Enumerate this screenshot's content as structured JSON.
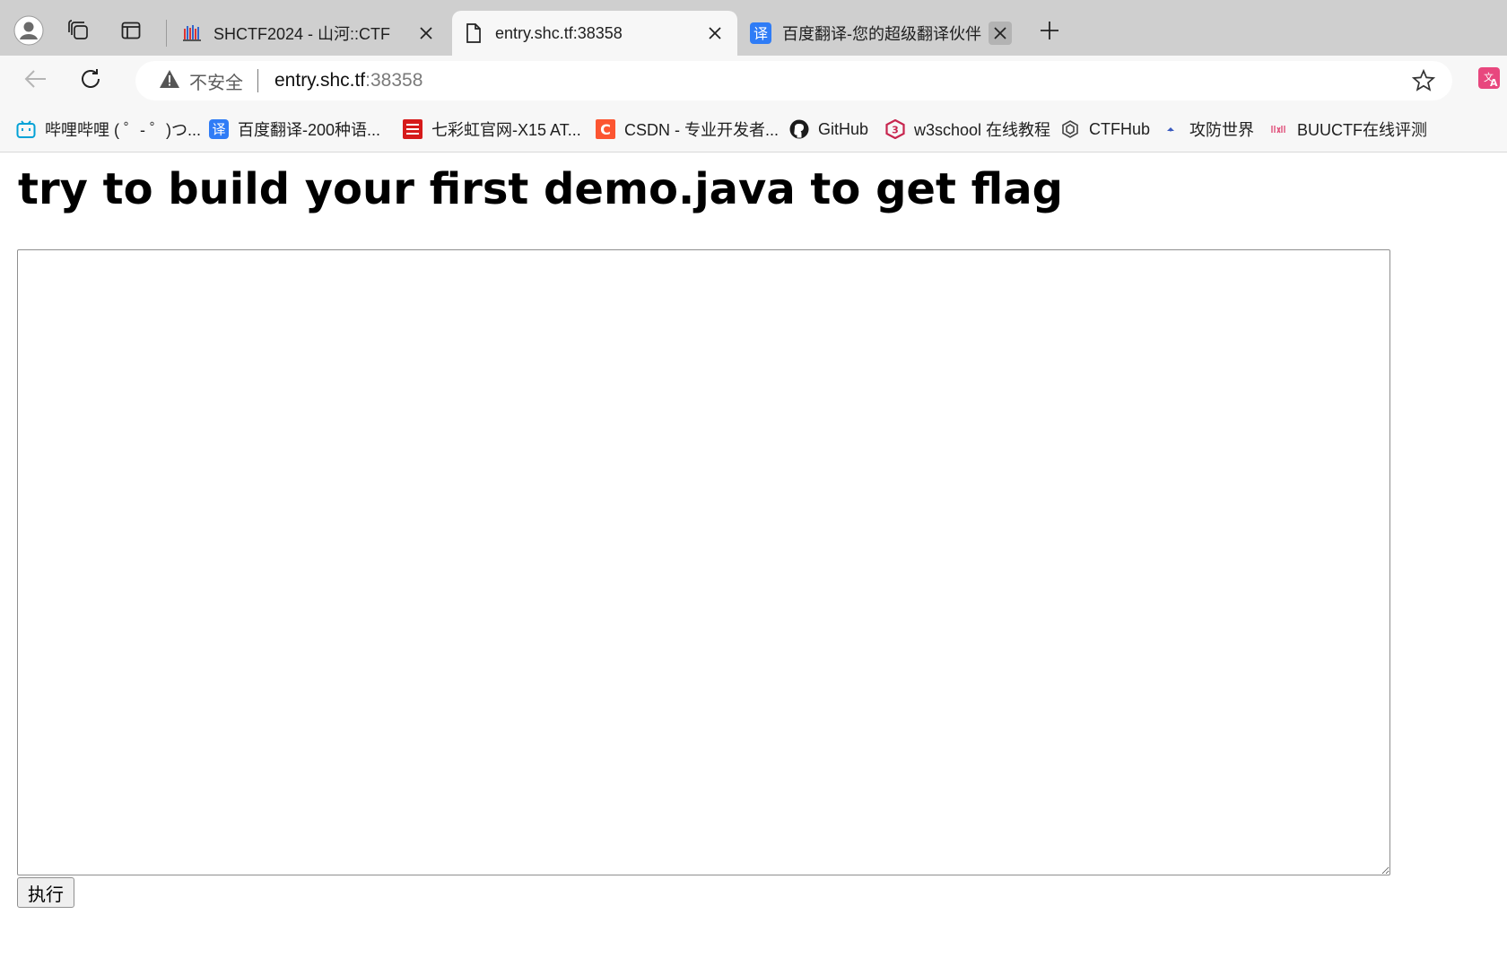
{
  "tabs": [
    {
      "title": "SHCTF2024 - 山河::CTF",
      "active": false
    },
    {
      "title": "entry.shc.tf:38358",
      "active": true
    },
    {
      "title": "百度翻译-您的超级翻译伙伴（文",
      "active": false
    }
  ],
  "address_bar": {
    "security_label": "不安全",
    "host": "entry.shc.tf",
    "port": ":38358"
  },
  "bookmarks": [
    {
      "label": "哔哩哔哩 ( ゜- ゜)つ...",
      "icon": "bilibili-icon"
    },
    {
      "label": "百度翻译-200种语...",
      "icon": "baidu-translate-icon"
    },
    {
      "label": "七彩虹官网-X15 AT...",
      "icon": "colorful-icon"
    },
    {
      "label": "CSDN - 专业开发者...",
      "icon": "csdn-icon"
    },
    {
      "label": "GitHub",
      "icon": "github-icon"
    },
    {
      "label": "w3school 在线教程",
      "icon": "w3school-icon"
    },
    {
      "label": "CTFHub",
      "icon": "ctfhub-icon"
    },
    {
      "label": "攻防世界",
      "icon": "adworld-icon"
    },
    {
      "label": "BUUCTF在线评测",
      "icon": "buuctf-icon"
    }
  ],
  "page": {
    "heading": "try to build your first demo.java to get flag",
    "code_input": {
      "value": "",
      "placeholder": ""
    },
    "submit_label": "执行"
  },
  "colors": {
    "tab_strip": "#cfcfcf",
    "toolbar": "#f7f7f7",
    "csdn_red": "#fc5531",
    "baidu_blue": "#2f7cf6",
    "bilibili_blue": "#00a1d6"
  }
}
